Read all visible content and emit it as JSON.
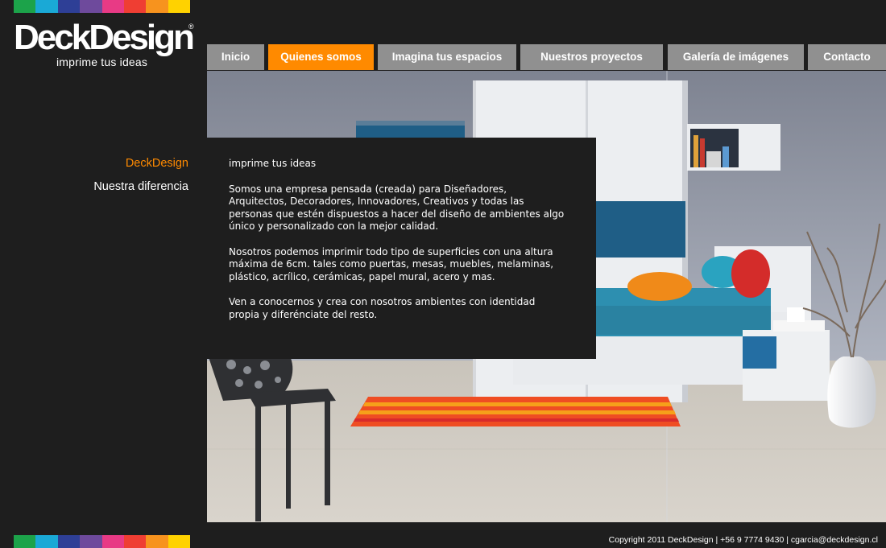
{
  "brand": {
    "name": "DeckDesign",
    "registered": "®",
    "tagline": "imprime tus ideas"
  },
  "stripe_colors": [
    "#1ca34a",
    "#1aa9d6",
    "#2e3f96",
    "#6e4a9c",
    "#e83a85",
    "#ef3e33",
    "#f7931e",
    "#ffd200"
  ],
  "colors": {
    "accent": "#ff8a00",
    "nav_bg": "#909090",
    "page_bg": "#1e1e1e"
  },
  "nav": {
    "tabs": [
      {
        "label": "Inicio"
      },
      {
        "label": "Quienes somos",
        "active": true
      },
      {
        "label": "Imagina tus espacios"
      },
      {
        "label": "Nuestros proyectos"
      },
      {
        "label": "Galería de imágenes"
      },
      {
        "label": "Contacto"
      }
    ]
  },
  "side_nav": {
    "items": [
      {
        "label": "DeckDesign",
        "active": true
      },
      {
        "label": "Nuestra diferencia"
      }
    ]
  },
  "content": {
    "paragraphs": [
      "imprime tus ideas",
      "Somos una empresa pensada (creada) para Diseñadores, Arquitectos, Decoradores, Innovadores, Creativos y todas las personas que estén dispuestos a hacer del diseño de ambientes algo único y personalizado con la mejor calidad.",
      "Nosotros podemos imprimir todo tipo de superficies con una altura máxima de 6cm. tales como puertas, mesas, muebles, melaminas, plástico, acrílico, cerámicas, papel mural, acero y mas.",
      "Ven a conocernos y crea con nosotros ambientes con identidad propia y diferénciate del resto."
    ]
  },
  "footer": {
    "copyright": "Copyright 2011 DeckDesign | +56 9 7774 9430 | cgarcia@deckdesign.cl"
  }
}
